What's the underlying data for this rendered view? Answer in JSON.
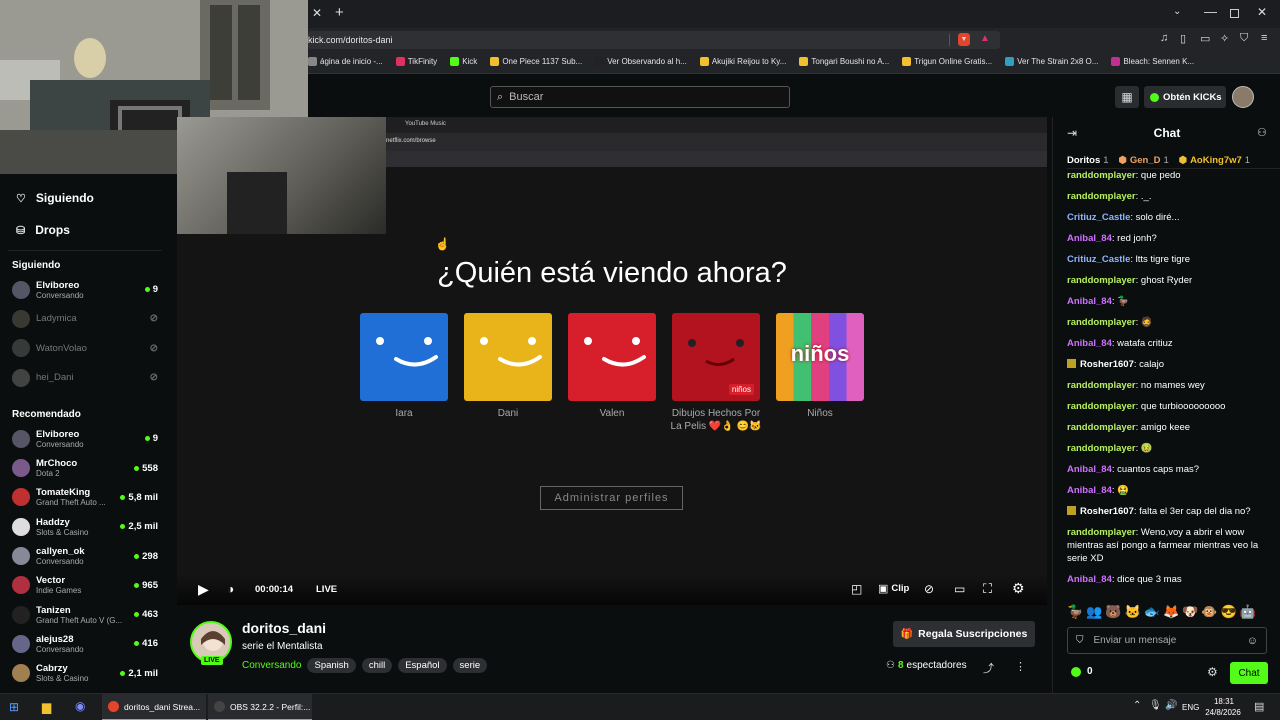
{
  "browser": {
    "url": "kick.com/doritos-dani",
    "bookmarks": [
      {
        "label": "ágina de inicio -...",
        "color": "#888"
      },
      {
        "label": "TikFinity",
        "color": "#e03060"
      },
      {
        "label": "Kick",
        "color": "#53fc18"
      },
      {
        "label": "One Piece 1137 Sub...",
        "color": "#f0c030"
      },
      {
        "label": "Ver Observando al h...",
        "color": "#222"
      },
      {
        "label": "Akujiki Reijou to Ky...",
        "color": "#f0c030"
      },
      {
        "label": "Tongari Boushi no A...",
        "color": "#f0c030"
      },
      {
        "label": "Trigun Online Gratis...",
        "color": "#f0c030"
      },
      {
        "label": "Ver The Strain 2x8 O...",
        "color": "#30a0c0"
      },
      {
        "label": "Bleach: Sennen K...",
        "color": "#c03090"
      }
    ]
  },
  "header": {
    "search_placeholder": "Buscar",
    "get_kicks": "Obtén KICKs"
  },
  "sidebar": {
    "nav": [
      {
        "label": "Siguiendo"
      },
      {
        "label": "Drops"
      }
    ],
    "following_title": "Siguiendo",
    "following": [
      {
        "name": "Elviboreo",
        "sub": "Conversando",
        "viewers": "9",
        "live": true,
        "avatar": "#556"
      },
      {
        "name": "Ladymica",
        "sub": "",
        "viewers": "",
        "live": false,
        "avatar": "#665"
      },
      {
        "name": "WatonVolao",
        "sub": "",
        "viewers": "",
        "live": false,
        "avatar": "#666"
      },
      {
        "name": "hei_Dani",
        "sub": "",
        "viewers": "",
        "live": false,
        "avatar": "#777"
      }
    ],
    "recommended_title": "Recomendado",
    "recommended": [
      {
        "name": "Elviboreo",
        "sub": "Conversando",
        "viewers": "9",
        "avatar": "#556"
      },
      {
        "name": "MrChoco",
        "sub": "Dota 2",
        "viewers": "558",
        "avatar": "#7a5a8a"
      },
      {
        "name": "TomateKing",
        "sub": "Grand Theft Auto ...",
        "viewers": "5,8 mil",
        "avatar": "#c03030"
      },
      {
        "name": "Haddzy",
        "sub": "Slots & Casino",
        "viewers": "2,5 mil",
        "avatar": "#ddd"
      },
      {
        "name": "callyen_ok",
        "sub": "Conversando",
        "viewers": "298",
        "avatar": "#889"
      },
      {
        "name": "Vector",
        "sub": "Indie Games",
        "viewers": "965",
        "avatar": "#b03040"
      },
      {
        "name": "Tanizen",
        "sub": "Grand Theft Auto V (G...",
        "viewers": "463",
        "avatar": "#222"
      },
      {
        "name": "alejus28",
        "sub": "Conversando",
        "viewers": "416",
        "avatar": "#668"
      },
      {
        "name": "Cabrzy",
        "sub": "Slots & Casino",
        "viewers": "2,1 mil",
        "avatar": "#a08050"
      }
    ]
  },
  "video": {
    "inner_tab": "YouTube Music",
    "inner_url": "netflix.com/browse",
    "who": "¿Quién está viendo ahora?",
    "profiles": [
      {
        "name": "Iara",
        "color": "#1f6fd6"
      },
      {
        "name": "Dani",
        "color": "#e8b41a"
      },
      {
        "name": "Valen",
        "color": "#d61f2a"
      },
      {
        "name": "Dibujos Hechos Por La Pelis ❤️👌 😊🐱",
        "color": "#b3131f",
        "badge": "niños"
      },
      {
        "name": "Niños",
        "color": "#e0e0e0",
        "badge": "niños"
      }
    ],
    "manage_profiles": "Administrar perfiles",
    "time": "00:00:14",
    "live": "LIVE",
    "clip": "Clip"
  },
  "stream": {
    "channel": "doritos_dani",
    "title": "serie el Mentalista",
    "category": "Conversando",
    "tags": [
      "Spanish",
      "chill",
      "Español",
      "serie"
    ],
    "viewers": "8",
    "viewers_label": "espectadores",
    "live_badge": "LIVE",
    "gift": "Regala Suscripciones"
  },
  "chat": {
    "title": "Chat",
    "gifters": [
      {
        "name": "Doritos",
        "count": "1",
        "color": "#fff"
      },
      {
        "name": "Gen_D",
        "count": "1",
        "color": "#f0a060"
      },
      {
        "name": "AoKing7w7",
        "count": "1",
        "color": "#f0c030"
      }
    ],
    "messages": [
      {
        "user": "randdomplayer",
        "color": "#b8f060",
        "text": "que pedo"
      },
      {
        "user": "randdomplayer",
        "color": "#b8f060",
        "text": "._."
      },
      {
        "user": "Critiuz_Castle",
        "color": "#8fb4ff",
        "text": "solo diré..."
      },
      {
        "user": "Anibal_84",
        "color": "#d070ff",
        "text": "red jonh?"
      },
      {
        "user": "Critiuz_Castle",
        "color": "#8fb4ff",
        "text": "ltts tigre tigre"
      },
      {
        "user": "randdomplayer",
        "color": "#b8f060",
        "text": "ghost Ryder"
      },
      {
        "user": "Anibal_84",
        "color": "#d070ff",
        "text": "🦆"
      },
      {
        "user": "randdomplayer",
        "color": "#b8f060",
        "text": "🧔"
      },
      {
        "user": "Anibal_84",
        "color": "#d070ff",
        "text": "watafa critiuz"
      },
      {
        "user": "Rosher1607",
        "color": "#fff",
        "text": "calajo"
      },
      {
        "user": "randdomplayer",
        "color": "#b8f060",
        "text": "no mames wey"
      },
      {
        "user": "randdomplayer",
        "color": "#b8f060",
        "text": "que turbiooooooooo"
      },
      {
        "user": "randdomplayer",
        "color": "#b8f060",
        "text": "amigo keee"
      },
      {
        "user": "randdomplayer",
        "color": "#b8f060",
        "text": "🤢"
      },
      {
        "user": "Anibal_84",
        "color": "#d070ff",
        "text": "cuantos caps mas?"
      },
      {
        "user": "Anibal_84",
        "color": "#d070ff",
        "text": "🤮"
      },
      {
        "user": "Rosher1607",
        "color": "#fff",
        "text": "falta el 3er cap del dia no?"
      },
      {
        "user": "randdomplayer",
        "color": "#b8f060",
        "text": "Weno,voy a abrir el wow mientras así pongo a farmear mientras veo la serie XD"
      },
      {
        "user": "Anibal_84",
        "color": "#d070ff",
        "text": "dice que 3 mas"
      }
    ],
    "input_placeholder": "Enviar un mensaje",
    "points": "0",
    "send": "Chat"
  },
  "taskbar": {
    "apps": [
      {
        "label": "doritos_dani Strea...",
        "icon": "brave-icon"
      },
      {
        "label": "OBS 32.2.2 - Perfil:...",
        "icon": "obs-icon"
      }
    ],
    "lang": "ENG",
    "time": "18:31",
    "date": "24/8/2026"
  },
  "colors": {
    "accent": "#53fc18",
    "bg": "#0b0e0f"
  }
}
